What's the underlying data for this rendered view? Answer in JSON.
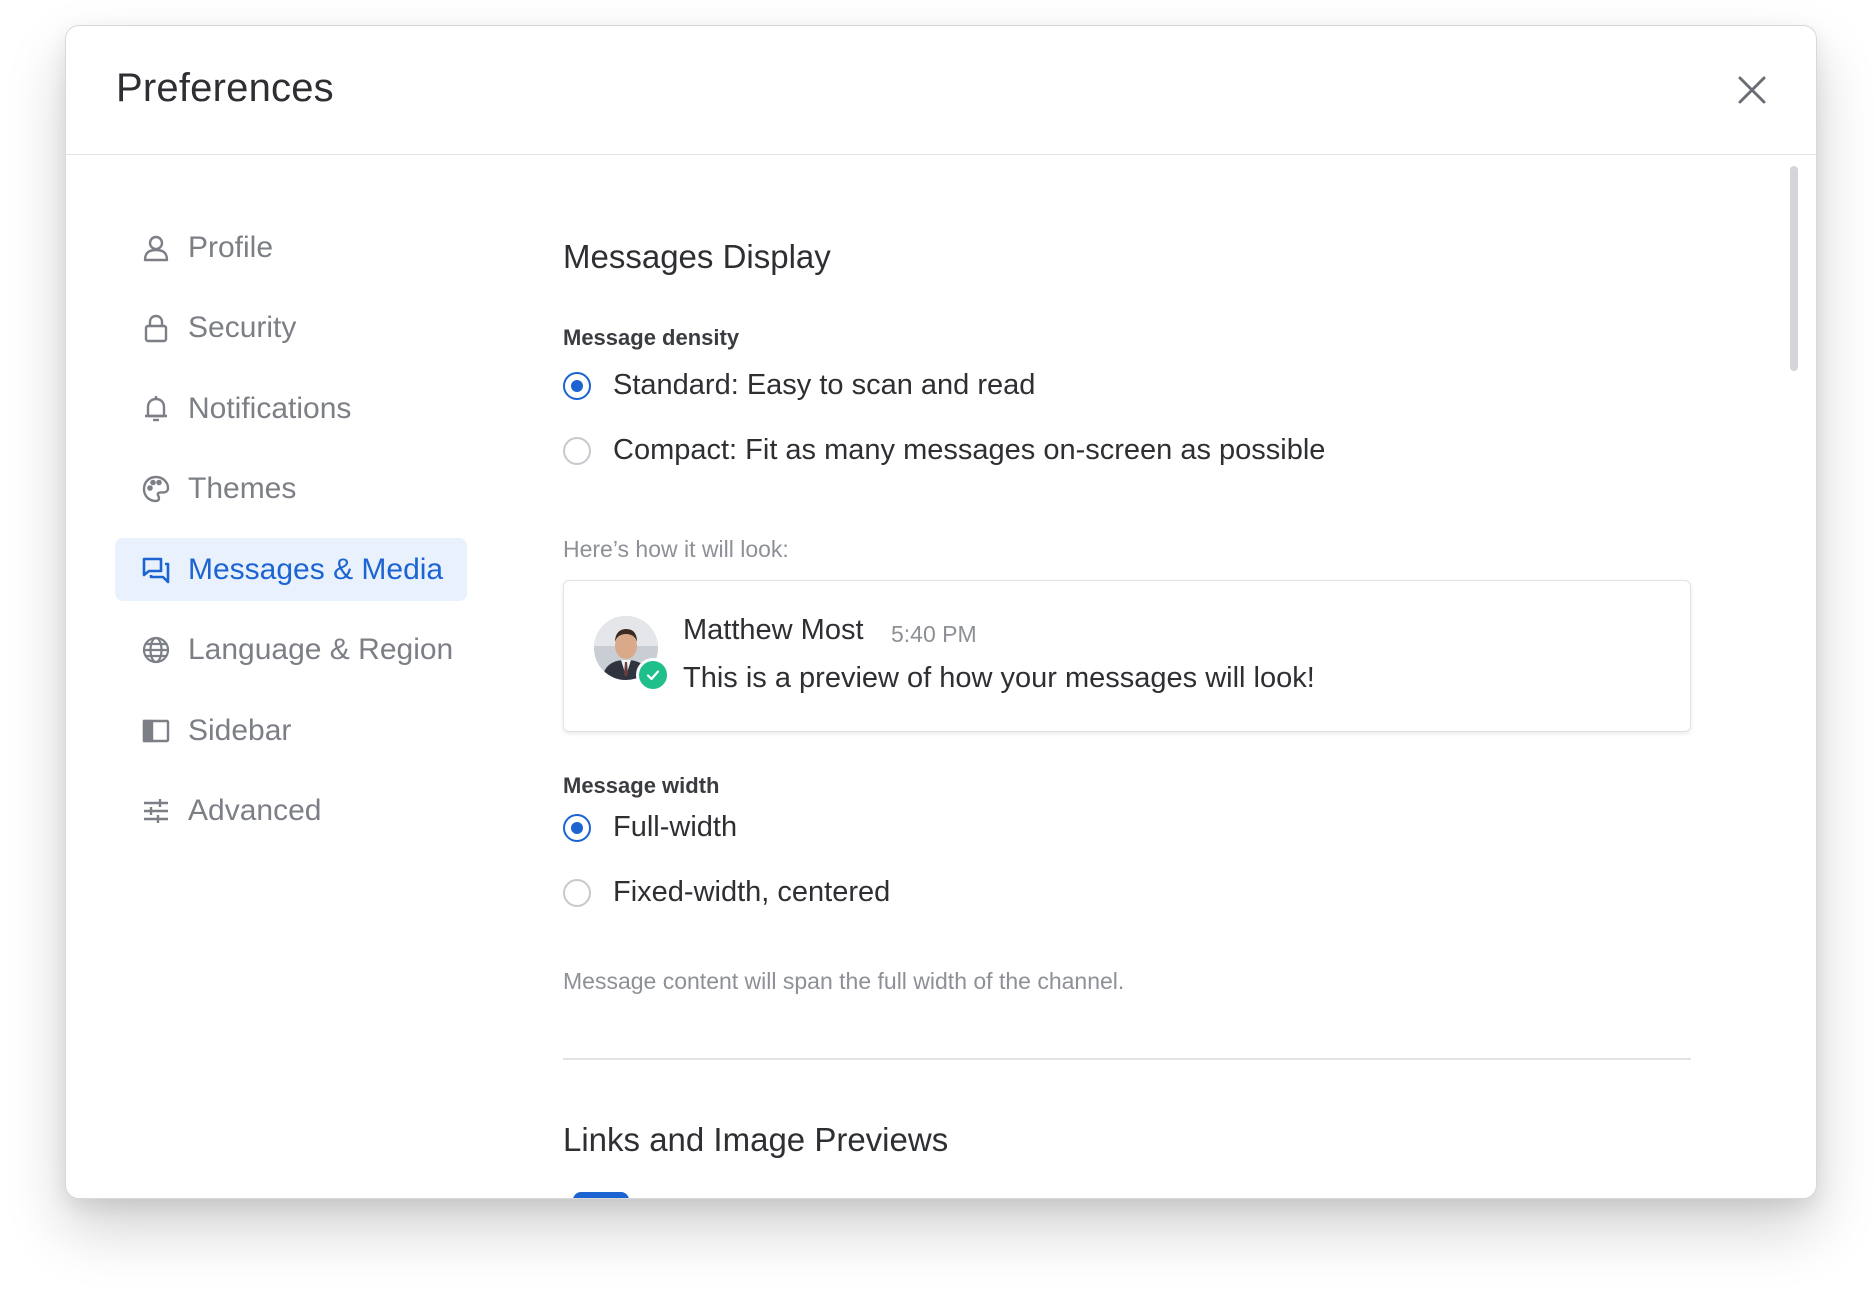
{
  "modal": {
    "title": "Preferences",
    "close_icon": "close-icon"
  },
  "sidebar": {
    "items": [
      {
        "label": "Profile",
        "icon": "user-icon",
        "active": false
      },
      {
        "label": "Security",
        "icon": "lock-icon",
        "active": false
      },
      {
        "label": "Notifications",
        "icon": "bell-icon",
        "active": false
      },
      {
        "label": "Themes",
        "icon": "palette-icon",
        "active": false
      },
      {
        "label": "Messages & Media",
        "icon": "messages-icon",
        "active": true
      },
      {
        "label": "Language & Region",
        "icon": "globe-icon",
        "active": false
      },
      {
        "label": "Sidebar",
        "icon": "sidebar-icon",
        "active": false
      },
      {
        "label": "Advanced",
        "icon": "sliders-icon",
        "active": false
      }
    ]
  },
  "messages_display": {
    "title": "Messages Display",
    "density": {
      "label": "Message density",
      "options": [
        {
          "label": "Standard: Easy to scan and read",
          "selected": true
        },
        {
          "label": "Compact: Fit as many messages on-screen as possible",
          "selected": false
        }
      ]
    },
    "preview": {
      "hint": "Here’s how it will look:",
      "author": "Matthew Most",
      "time": "5:40 PM",
      "text": "This is a preview of how your messages will look!",
      "status": "online"
    },
    "width": {
      "label": "Message width",
      "options": [
        {
          "label": "Full-width",
          "selected": true
        },
        {
          "label": "Fixed-width, centered",
          "selected": false
        }
      ],
      "help": "Message content will span the full width of the channel."
    }
  },
  "links_previews": {
    "title": "Links and Image Previews"
  },
  "colors": {
    "accent": "#1c64d2",
    "active_bg": "#e9f1fd",
    "online": "#1ebf8b"
  }
}
